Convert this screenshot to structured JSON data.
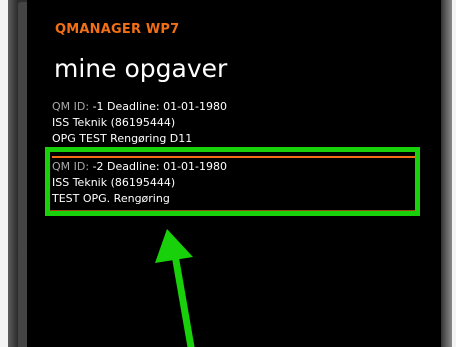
{
  "app": {
    "title": "QMANAGER WP7",
    "page_title": "mine opgaver",
    "accent_color": "#f26f16",
    "highlight_color": "#19d10a"
  },
  "tasks": [
    {
      "id_label": "QM ID:",
      "id_value": "-1",
      "deadline_label": "Deadline:",
      "deadline_value": "01-01-1980",
      "company": "ISS Teknik (86195444)",
      "description": "OPG TEST Rengøring D11"
    },
    {
      "id_label": "QM ID:",
      "id_value": "-2",
      "deadline_label": "Deadline:",
      "deadline_value": "01-01-1980",
      "company": "ISS Teknik (86195444)",
      "description": "TEST OPG. Rengøring"
    }
  ],
  "annotation": {
    "icon": "arrow-up-icon"
  }
}
